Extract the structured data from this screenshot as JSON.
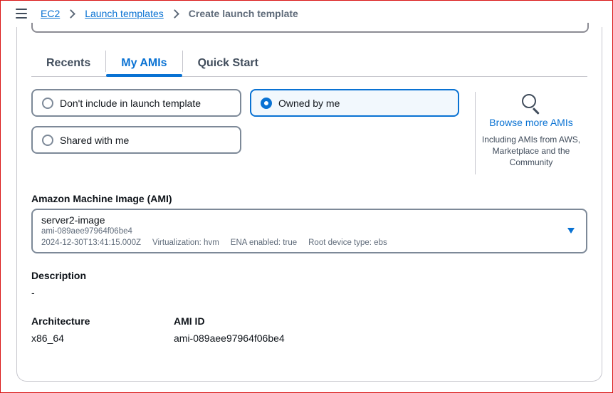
{
  "breadcrumb": {
    "items": [
      "EC2",
      "Launch templates"
    ],
    "current": "Create launch template"
  },
  "tabs": [
    "Recents",
    "My AMIs",
    "Quick Start"
  ],
  "active_tab": "My AMIs",
  "filters": {
    "dont_include": "Don't include in launch template",
    "owned_by_me": "Owned by me",
    "shared_with_me": "Shared with me",
    "selected": "Owned by me"
  },
  "browse": {
    "link": "Browse more AMIs",
    "description": "Including AMIs from AWS, Marketplace and the Community"
  },
  "ami": {
    "label": "Amazon Machine Image (AMI)",
    "name": "server2-image",
    "id": "ami-089aee97964f06be4",
    "created": "2024-12-30T13:41:15.000Z",
    "virtualization": "Virtualization: hvm",
    "ena": "ENA enabled: true",
    "root_device": "Root device type: ebs"
  },
  "details": {
    "description_label": "Description",
    "description_value": "-",
    "architecture_label": "Architecture",
    "architecture_value": "x86_64",
    "ami_id_label": "AMI ID",
    "ami_id_value": "ami-089aee97964f06be4"
  },
  "colors": {
    "accent": "#0972d3",
    "border": "#7d8998",
    "frame": "#d91515"
  }
}
